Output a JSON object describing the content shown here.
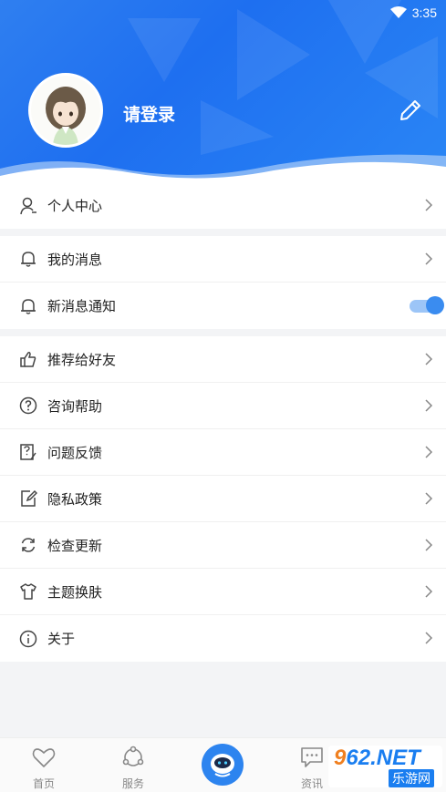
{
  "status_bar": {
    "time": "3:35",
    "wifi_icon": "wifi-icon"
  },
  "header": {
    "login_label": "请登录",
    "avatar_icon": "user-avatar",
    "edit_icon": "pencil-icon"
  },
  "menu": {
    "section1": [
      {
        "label": "个人中心",
        "icon": "user-icon"
      }
    ],
    "section2": [
      {
        "label": "我的消息",
        "icon": "bell-icon"
      },
      {
        "label": "新消息通知",
        "icon": "bell-icon",
        "toggle": true,
        "toggle_on": true
      }
    ],
    "section3": [
      {
        "label": "推荐给好友",
        "icon": "thumbs-up-icon"
      },
      {
        "label": "咨询帮助",
        "icon": "question-icon"
      },
      {
        "label": "问题反馈",
        "icon": "feedback-icon"
      },
      {
        "label": "隐私政策",
        "icon": "edit-document-icon"
      },
      {
        "label": "检查更新",
        "icon": "refresh-icon"
      },
      {
        "label": "主题换肤",
        "icon": "tshirt-icon"
      },
      {
        "label": "关于",
        "icon": "info-icon"
      }
    ]
  },
  "bottom_nav": {
    "items": [
      {
        "label": "首页",
        "icon": "heart-icon"
      },
      {
        "label": "服务",
        "icon": "service-icon"
      },
      {
        "label": "",
        "icon": "robot-icon"
      },
      {
        "label": "资讯",
        "icon": "chat-icon"
      }
    ]
  },
  "watermark": {
    "line1_a": "9",
    "line1_b": "62",
    "line1_c": ".NET",
    "line2": "乐游网"
  },
  "colors": {
    "primary": "#2a80f0",
    "toggle_on": "#3a8cf0"
  }
}
